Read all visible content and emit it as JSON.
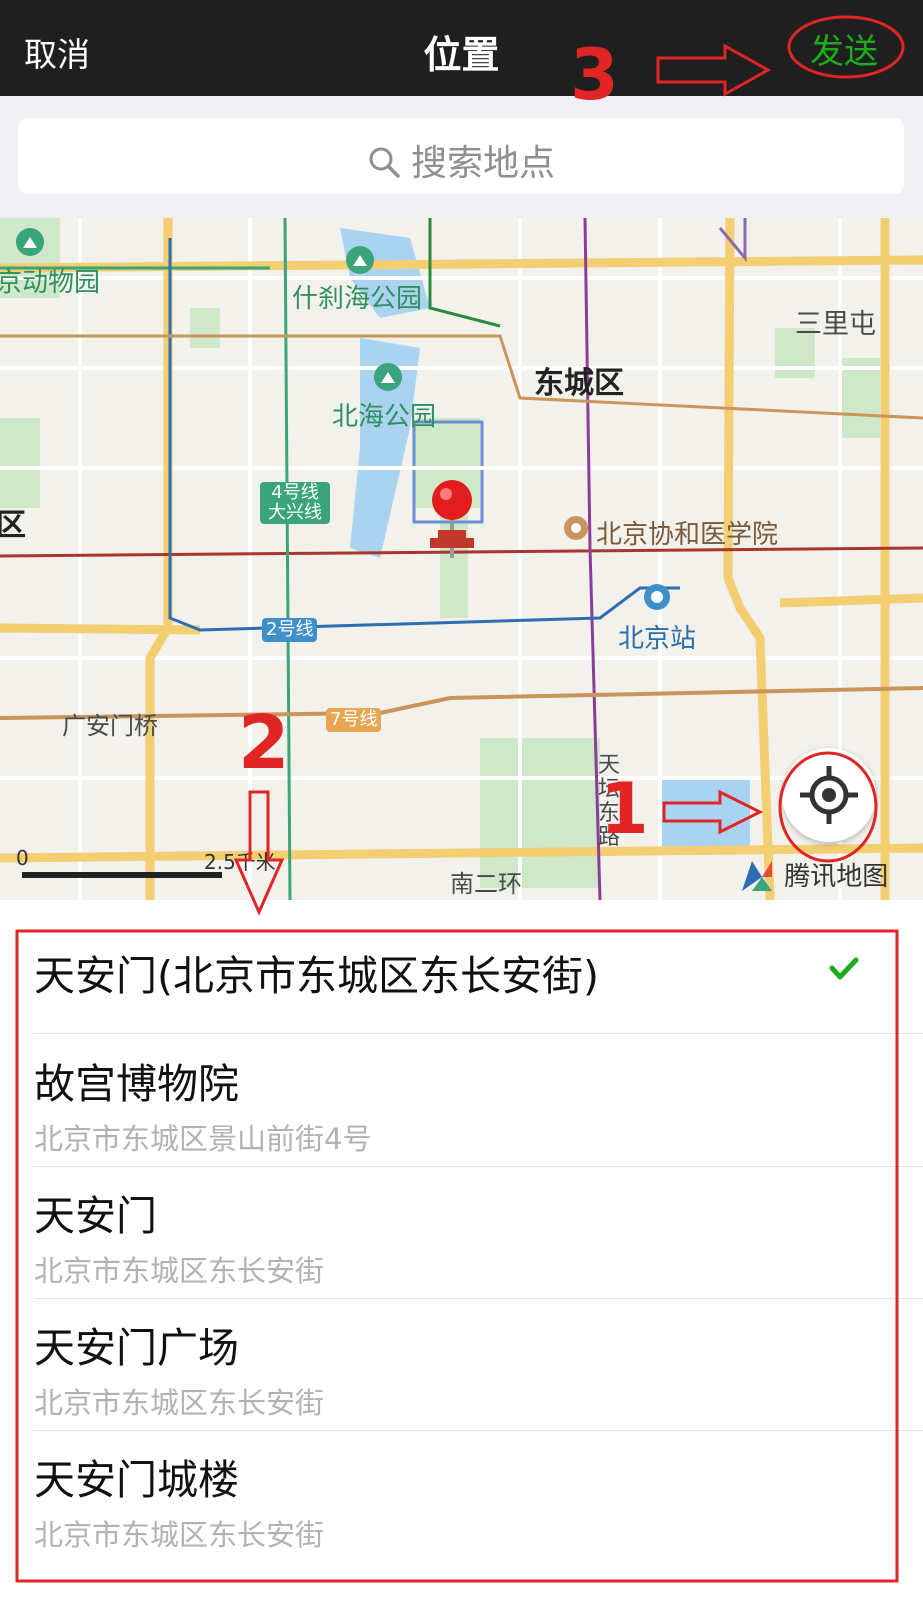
{
  "topbar": {
    "cancel_label": "取消",
    "title": "位置",
    "send_label": "发送"
  },
  "search": {
    "placeholder": "搜索地点"
  },
  "map": {
    "labels": {
      "zoo": "京动物园",
      "shichahai": "什刹海公园",
      "beihai": "北海公园",
      "sanlitun": "三里屯",
      "dongcheng": "东城区",
      "xicheng_partial": "区",
      "pumc": "北京协和医学院",
      "beijing_station": "北京站",
      "guanganmen": "广安门桥",
      "tiantan_road": "天坛东路",
      "nanerhuan": "南二环"
    },
    "badges": {
      "line4": "4号线\n大兴线",
      "line2": "2号线",
      "line7": "7号线"
    },
    "scale_start": "0",
    "scale_end": "2.5千米",
    "brand": "腾讯地图"
  },
  "results": [
    {
      "name": "天安门(北京市东城区东长安街)",
      "address": "",
      "selected": true
    },
    {
      "name": "故宫博物院",
      "address": "北京市东城区景山前街4号",
      "selected": false
    },
    {
      "name": "天安门",
      "address": "北京市东城区东长安街",
      "selected": false
    },
    {
      "name": "天安门广场",
      "address": "北京市东城区东长安街",
      "selected": false
    },
    {
      "name": "天安门城楼",
      "address": "北京市东城区东长安街",
      "selected": false
    }
  ],
  "annotations": {
    "step1": "1",
    "step2": "2",
    "step3": "3"
  },
  "colors": {
    "accent_green": "#1aad19",
    "annotation_red": "#e12424",
    "topbar": "#1f1f1f"
  }
}
